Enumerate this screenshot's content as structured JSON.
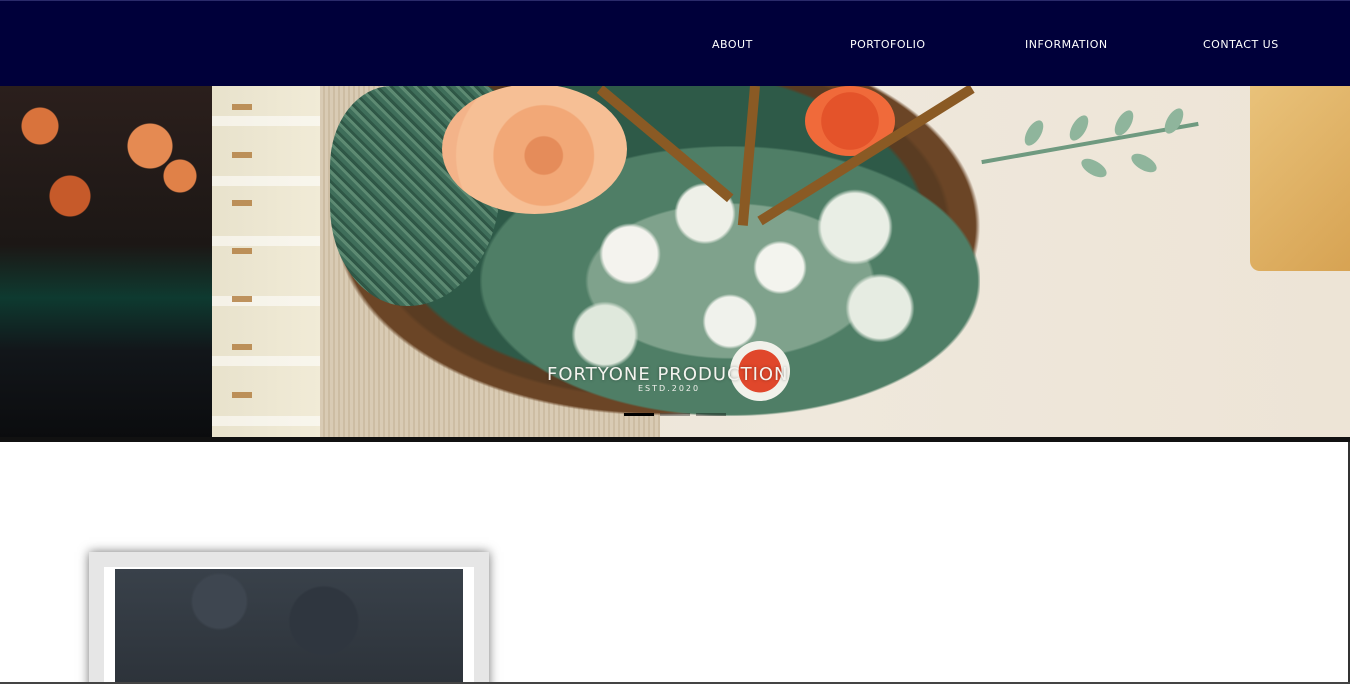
{
  "nav": {
    "items": [
      {
        "label": "ABOUT"
      },
      {
        "label": "PORTOFOLIO"
      },
      {
        "label": "INFORMATION"
      },
      {
        "label": "CONTACT US"
      }
    ]
  },
  "hero": {
    "brand": "FORTYONE PRODUCTION",
    "established": "ESTD.2020",
    "slides": {
      "count": 3,
      "active_index": 0
    }
  },
  "colors": {
    "navbar_bg": "#00003a",
    "nav_text": "#ffffff",
    "indicator_active": "#000000"
  }
}
